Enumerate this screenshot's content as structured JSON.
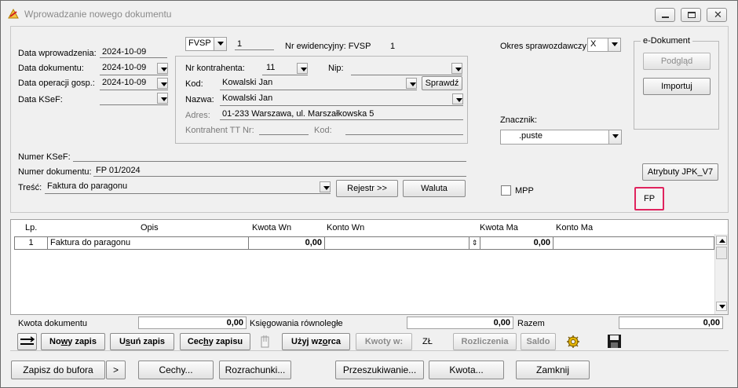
{
  "window": {
    "title": "Wprowadzanie nowego dokumentu"
  },
  "dates": {
    "data_wprowadzenia_label": "Data wprowadzenia:",
    "data_wprowadzenia_value": "2024-10-09",
    "data_dokumentu_label": "Data dokumentu:",
    "data_dokumentu_value": "2024-10-09",
    "data_operacji_label": "Data operacji gosp.:",
    "data_operacji_value": "2024-10-09",
    "data_ksef_label": "Data KSeF:",
    "data_ksef_value": ""
  },
  "register": {
    "value": "FVSP",
    "number": "1",
    "nr_ewidencyjny_label": "Nr ewidencyjny: FVSP",
    "nr_ewidencyjny_value": "1"
  },
  "contractor": {
    "nr_label": "Nr kontrahenta:",
    "nr_value": "11",
    "nip_label": "Nip:",
    "nip_value": "",
    "kod_label": "Kod:",
    "kod_value": "Kowalski Jan",
    "sprawdz_label": "Sprawdź",
    "nazwa_label": "Nazwa:",
    "nazwa_value": "Kowalski Jan",
    "adres_label": "Adres:",
    "adres_value": "01-233 Warszawa, ul. Marszałkowska 5",
    "tt_label": "Kontrahent TT Nr:",
    "tt_value": "",
    "tt_kod_label": "Kod:",
    "tt_kod_value": ""
  },
  "right": {
    "okres_label": "Okres sprawozdawczy:",
    "okres_value": "X",
    "edokument_title": "e-Dokument",
    "podglad_label": "Podgląd",
    "importuj_label": "Importuj",
    "znacznik_label": "Znacznik:",
    "znacznik_value": ".puste",
    "atrybuty_label": "Atrybuty JPK_V7",
    "mpp_label": "MPP",
    "fp_label": "FP"
  },
  "document": {
    "ksef_label": "Numer KSeF:",
    "ksef_value": "",
    "numer_label": "Numer dokumentu:",
    "numer_value": "FP 01/2024",
    "tresc_label": "Treść:",
    "tresc_value": "Faktura do paragonu",
    "rejestr_label": "Rejestr >>",
    "waluta_label": "Waluta"
  },
  "grid": {
    "columns": [
      "Lp.",
      "Opis",
      "Kwota  Wn",
      "Konto  Wn",
      "Kwota Ma",
      "Konto Ma"
    ],
    "rows": [
      {
        "lp": "1",
        "opis": "Faktura do paragonu",
        "kwota_wn": "0,00",
        "konto_wn": "",
        "kwota_ma": "0,00",
        "konto_ma": ""
      }
    ]
  },
  "summary": {
    "kwota_dokumentu_label": "Kwota dokumentu",
    "kwota_dokumentu_value": "0,00",
    "ksiegowania_label": "Księgowania równoległe",
    "ksiegowania_value": "0,00",
    "razem_label": "Razem",
    "razem_value": "0,00"
  },
  "toolbar": {
    "nowy_zapis": "Nowy zapis",
    "usun_zapis": "Usuń zapis",
    "cechy_zapisu": "Cechy zapisu",
    "uzyj_wzorca": "Użyj wzorca",
    "kwoty_w": "Kwoty w:",
    "currency": "ZŁ",
    "rozliczenia": "Rozliczenia",
    "saldo": "Saldo"
  },
  "bottom": {
    "zapisz_do_bufora": "Zapisz do bufora",
    "more": ">",
    "cechy": "Cechy...",
    "rozrachunki": "Rozrachunki...",
    "przeszukiwanie": "Przeszukiwanie...",
    "kwota": "Kwota...",
    "zamknij": "Zamknij"
  },
  "colors": {
    "highlight_border": "#e0245e",
    "window_bg": "#f0f0f0"
  }
}
